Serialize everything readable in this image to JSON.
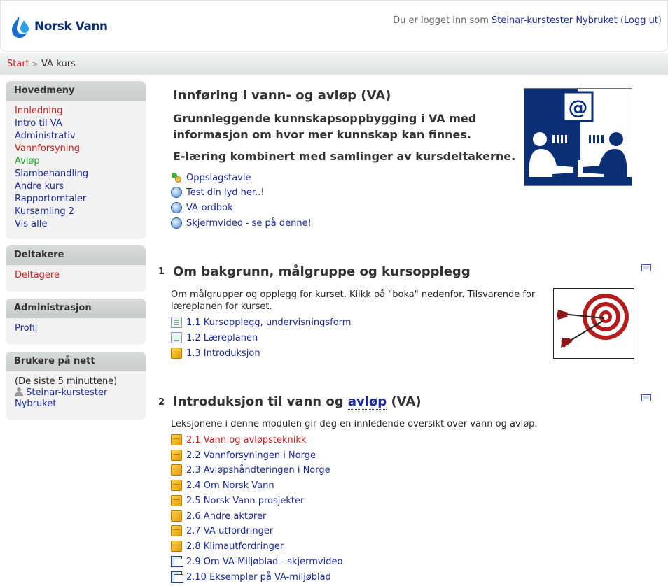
{
  "header": {
    "brand": "Norsk Vann",
    "login_prefix": "Du er logget inn som",
    "user_name": "Steinar-kurstester Nybruket",
    "logout": "Logg ut"
  },
  "breadcrumb": {
    "home": "Start",
    "separator": ">",
    "current": "VA-kurs"
  },
  "sidebar": {
    "main_menu": {
      "title": "Hovedmeny",
      "items": [
        {
          "label": "Innledning",
          "color": "#c81e1e"
        },
        {
          "label": "Intro til VA",
          "color": "#1a2a9c"
        },
        {
          "label": "Administrativ",
          "color": "#1a2a9c"
        },
        {
          "label": "Vannforsyning",
          "color": "#c81e1e"
        },
        {
          "label": "Avløp",
          "color": "#22a02a"
        },
        {
          "label": "Slambehandling",
          "color": "#1a2a9c"
        },
        {
          "label": "Andre kurs",
          "color": "#1a2a9c"
        },
        {
          "label": "Rapportomtaler",
          "color": "#1a2a9c"
        },
        {
          "label": "Kursamling 2",
          "color": "#1a2a9c"
        },
        {
          "label": "Vis alle",
          "color": "#1a2a9c"
        }
      ]
    },
    "participants": {
      "title": "Deltakere",
      "link": "Deltagere"
    },
    "admin": {
      "title": "Administrasjon",
      "link": "Profil"
    },
    "online": {
      "title": "Brukere på nett",
      "note": "(De siste 5 minuttene)",
      "user": "Steinar-kurstester Nybruket"
    }
  },
  "intro": {
    "title": "Innføring i vann- og avløp (VA)",
    "subtitle1": "Grunnleggende kunnskapsoppbygging i VA med informasjon om hvor mer kunnskap kan finnes.",
    "subtitle2": "E-læring kombinert med samlinger av kursdeltakerne.",
    "resources": [
      {
        "label": "Oppslagstavle",
        "icon": "forum-icon"
      },
      {
        "label": "Test din lyd her..!",
        "icon": "web-resource-icon"
      },
      {
        "label": "VA-ordbok",
        "icon": "web-resource-icon"
      },
      {
        "label": "Skjermvideo - se på denne!",
        "icon": "web-resource-icon"
      }
    ]
  },
  "sections": [
    {
      "number": "1",
      "title": "Om bakgrunn, målgruppe og kursopplegg",
      "summary": "Om målgrupper og opplegg for kurset. Klikk på \"boka\" nedenfor. Tilsvarende for læreplanen for kurset.",
      "items": [
        {
          "label": "1.1 Kursopplegg, undervisningsform",
          "icon": "page-icon",
          "color": "#1a2a9c"
        },
        {
          "label": "1.2 Læreplanen",
          "icon": "page-icon",
          "color": "#1a2a9c"
        },
        {
          "label": "1.3 Introduksjon",
          "icon": "package-icon",
          "color": "#1a2a9c"
        }
      ]
    },
    {
      "number": "2",
      "title_prefix": "Introduksjon til vann og ",
      "title_link": "avløp",
      "title_suffix": " (VA)",
      "summary": "Leksjonene i denne modulen gir deg en innledende oversikt over vann og avløp.",
      "items": [
        {
          "label": "2.1 Vann og avløpsteknikk",
          "icon": "package-icon",
          "color": "#c81e1e"
        },
        {
          "label": "2.2 Vannforsyningen i Norge",
          "icon": "package-icon",
          "color": "#1a2a9c"
        },
        {
          "label": "2.3 Avløpshåndteringen i Norge",
          "icon": "package-icon",
          "color": "#1a2a9c"
        },
        {
          "label": "2.4 Om Norsk Vann",
          "icon": "package-icon",
          "color": "#1a2a9c"
        },
        {
          "label": "2.5 Norsk Vann prosjekter",
          "icon": "package-icon",
          "color": "#1a2a9c"
        },
        {
          "label": "2.6 Andre aktører",
          "icon": "package-icon",
          "color": "#1a2a9c"
        },
        {
          "label": "2.7 VA-utfordringer",
          "icon": "package-icon",
          "color": "#1a2a9c"
        },
        {
          "label": "2.8 Klimautfordringer",
          "icon": "package-icon",
          "color": "#1a2a9c"
        },
        {
          "label": "2.9 Om VA-Miljøblad - skjermvideo",
          "icon": "screen-icon",
          "color": "#1a2a9c"
        },
        {
          "label": "2.10 Eksempler på VA-miljøblad",
          "icon": "screen-icon",
          "color": "#1a2a9c"
        }
      ]
    }
  ]
}
